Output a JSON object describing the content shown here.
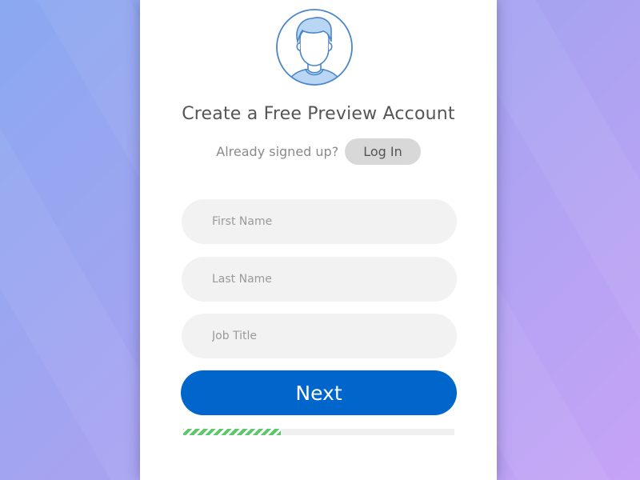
{
  "form": {
    "title": "Create a Free Preview Account",
    "login_prompt": "Already signed up?",
    "login_label": "Log In",
    "fields": [
      {
        "placeholder": "First Name",
        "value": ""
      },
      {
        "placeholder": "Last Name",
        "value": ""
      },
      {
        "placeholder": "Job Title",
        "value": ""
      }
    ],
    "next_label": "Next",
    "progress": 0.36
  },
  "icons": {
    "avatar": "user-avatar-icon"
  },
  "colors": {
    "primary": "#0066cc",
    "progress": "#5cc86a",
    "avatar_stroke": "#4a86c8",
    "avatar_fill": "#b9d6f5"
  }
}
